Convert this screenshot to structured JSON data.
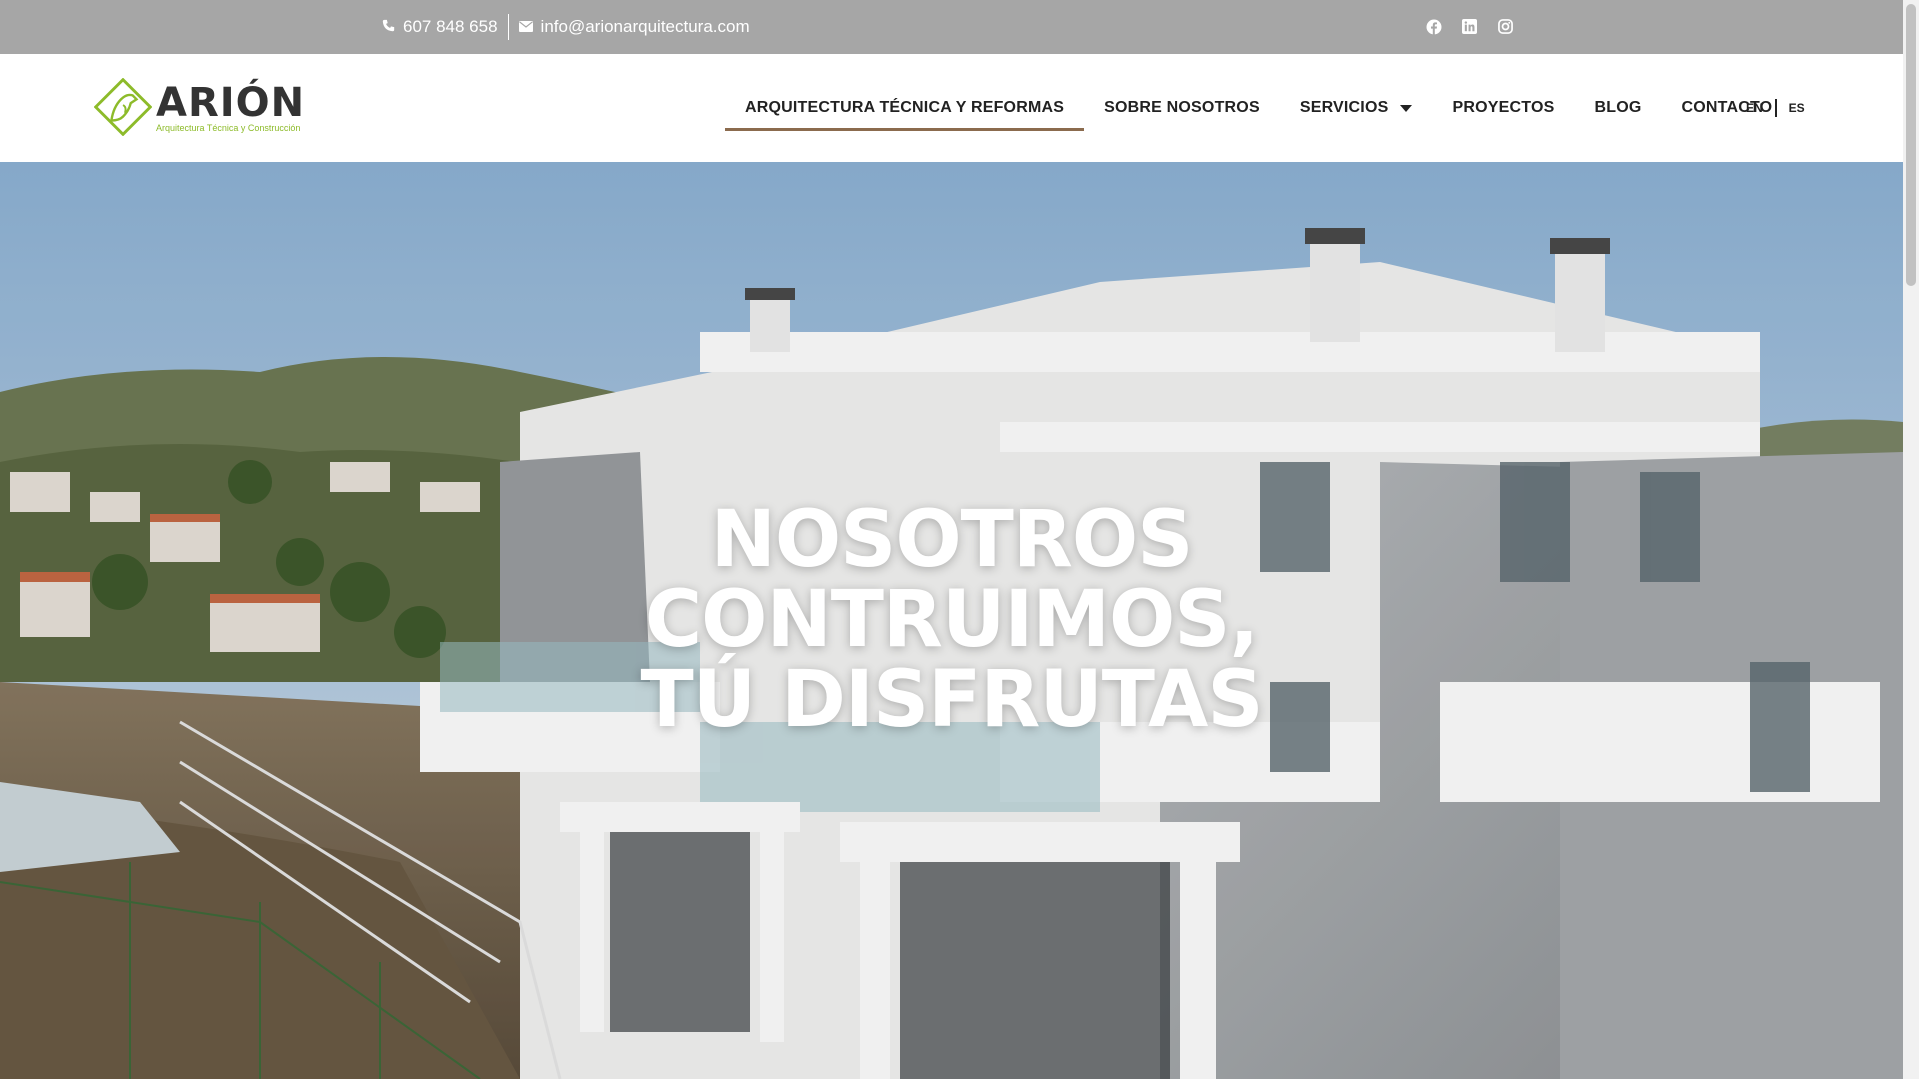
{
  "topbar": {
    "phone": "607 848 658",
    "email": "info@arionarquitectura.com",
    "social": [
      {
        "icon": "facebook-icon"
      },
      {
        "icon": "linkedin-icon"
      },
      {
        "icon": "instagram-icon"
      }
    ]
  },
  "logo": {
    "brand": "ARIÓN",
    "tagline": "Arquitectura Técnica y Construcción"
  },
  "nav": {
    "items": [
      {
        "label": "ARQUITECTURA TÉCNICA Y REFORMAS",
        "active": true
      },
      {
        "label": "SOBRE NOSOTROS"
      },
      {
        "label": "SERVICIOS",
        "dropdown": true
      },
      {
        "label": "PROYECTOS"
      },
      {
        "label": "BLOG"
      },
      {
        "label": "CONTACTO"
      }
    ],
    "languages": [
      "EN",
      "ES"
    ]
  },
  "hero": {
    "line1": "NOSOTROS",
    "line2": "CONTRUIMOS,",
    "line3": "TÚ DISFRUTAS"
  },
  "colors": {
    "topbar": "#a6a6a6",
    "accent_underline": "#8b6b4e",
    "logo_green": "#8dbb2a",
    "text_dark": "#222222"
  }
}
